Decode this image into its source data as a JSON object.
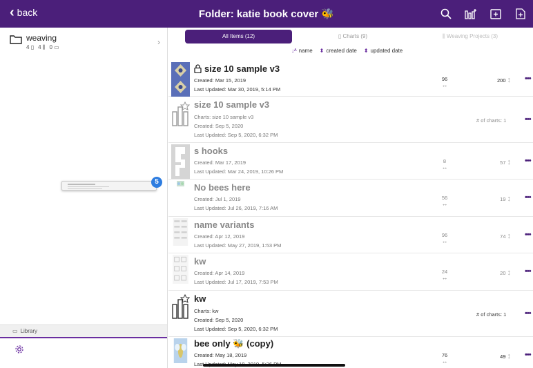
{
  "header": {
    "back_label": "back",
    "title": "Folder: katie book cover 🐝",
    "icons": [
      "search-icon",
      "chart-add-icon",
      "folder-add-icon",
      "file-add-icon"
    ]
  },
  "sidebar": {
    "folder": {
      "name": "weaving",
      "count_charts": "4",
      "count_projects": "4",
      "count_folders": "0"
    },
    "drag_badge": "5",
    "library_label": "Library"
  },
  "tabs": [
    {
      "label": "All Items (12)"
    },
    {
      "label": "Charts (9)"
    },
    {
      "label": "Weaving Projects (3)"
    }
  ],
  "sort": {
    "name": "name",
    "created": "created date",
    "updated": "updated date"
  },
  "rows": [
    {
      "name": "size 10 sample v3",
      "locked": true,
      "line1": "Created: Mar 15, 2019",
      "line2": "Last Updated: Mar 30, 2019, 5:14 PM",
      "width": "96",
      "height": "200",
      "muted": false
    },
    {
      "name": "size 10 sample v3",
      "line0": "Charts: size 10 sample v3",
      "line1": "Created: Sep 5, 2020",
      "line2": "Last Updated: Sep 5, 2020, 6:32 PM",
      "charts": "# of charts: 1",
      "muted": true
    },
    {
      "name": "s hooks",
      "line1": "Created: Mar 17, 2019",
      "line2": "Last Updated: Mar 24, 2019, 10:26 PM",
      "width": "8",
      "height": "57",
      "muted": true
    },
    {
      "name": "No bees here",
      "line1": "Created: Jul 1, 2019",
      "line2": "Last Updated: Jul 26, 2019, 7:16 AM",
      "width": "56",
      "height": "19",
      "muted": true
    },
    {
      "name": "name variants",
      "line1": "Created: Apr 12, 2019",
      "line2": "Last Updated: May 27, 2019, 1:53 PM",
      "width": "96",
      "height": "74",
      "muted": true
    },
    {
      "name": "kw",
      "line1": "Created: Apr 14, 2019",
      "line2": "Last Updated: Jul 17, 2019, 7:53 PM",
      "width": "24",
      "height": "20",
      "muted": true
    },
    {
      "name": "kw",
      "line0": "Charts: kw",
      "line1": "Created: Sep 5, 2020",
      "line2": "Last Updated: Sep 5, 2020, 6:32 PM",
      "charts": "# of charts: 1",
      "muted": false
    },
    {
      "name": "bee only 🐝 (copy)",
      "line1": "Created: May 18, 2019",
      "line2": "Last Updated: May 18, 2019, 5:26 PM",
      "width": "76",
      "height": "49",
      "muted": false
    }
  ],
  "colors": {
    "brand": "#4b1f7a",
    "accent": "#6a2ea0",
    "badge": "#2e7de0"
  }
}
